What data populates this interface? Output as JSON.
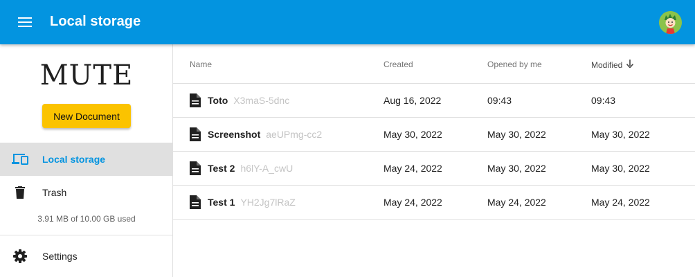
{
  "topbar": {
    "title": "Local storage",
    "menu_icon": "menu-icon",
    "avatar_icon": "avatar-icon",
    "color": "#0394e0"
  },
  "sidebar": {
    "logo": "MUTE",
    "new_document_label": "New Document",
    "items": [
      {
        "label": "Local storage",
        "icon": "devices-icon",
        "active": true
      },
      {
        "label": "Trash",
        "icon": "trash-icon",
        "active": false
      },
      {
        "label": "Settings",
        "icon": "gear-icon",
        "active": false
      }
    ],
    "storage_usage": "3.91 MB of 10.00 GB used"
  },
  "table": {
    "columns": {
      "name": "Name",
      "created": "Created",
      "opened": "Opened by me",
      "modified": "Modified"
    },
    "sort_column": "modified",
    "sort_direction": "descending",
    "rows": [
      {
        "name": "Toto",
        "signature": "X3maS-5dnc",
        "created": "Aug 16, 2022",
        "opened": "09:43",
        "modified": "09:43"
      },
      {
        "name": "Screenshot",
        "signature": "aeUPmg-cc2",
        "created": "May 30, 2022",
        "opened": "May 30, 2022",
        "modified": "May 30, 2022"
      },
      {
        "name": "Test 2",
        "signature": "h6lY-A_cwU",
        "created": "May 24, 2022",
        "opened": "May 30, 2022",
        "modified": "May 30, 2022"
      },
      {
        "name": "Test 1",
        "signature": "YH2Jg7lRaZ",
        "created": "May 24, 2022",
        "opened": "May 24, 2022",
        "modified": "May 24, 2022"
      }
    ]
  },
  "colors": {
    "accent": "#0394e0",
    "button": "#fbc300",
    "active_bg": "#e0e0e0"
  }
}
